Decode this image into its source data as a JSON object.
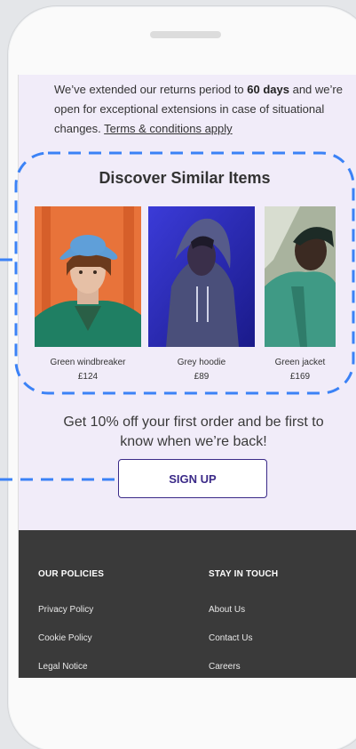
{
  "returns": {
    "text_before": "We’ve extended our returns period to ",
    "bold": "60 days",
    "text_after": " and we’re open for exceptional extensions in case of situational changes. ",
    "link": "Terms & conditions apply"
  },
  "similar": {
    "title": "Discover Similar Items",
    "items": [
      {
        "name": "Green windbreaker",
        "price": "£124"
      },
      {
        "name": "Grey hoodie",
        "price": "£89"
      },
      {
        "name": "Green jacket",
        "price": "£169"
      }
    ]
  },
  "promo": {
    "text": "Get 10% off your first order and be first to know when we’re back!",
    "button": "SIGN UP"
  },
  "footer": {
    "policies": {
      "heading": "OUR POLICIES",
      "links": [
        "Privacy Policy",
        "Cookie Policy",
        "Legal Notice"
      ]
    },
    "contact": {
      "heading": "STAY IN TOUCH",
      "links": [
        "About Us",
        "Contact Us",
        "Careers"
      ]
    }
  },
  "colors": {
    "accent": "#3b2a88",
    "annotation_dash": "#3b82f6",
    "footer_bg": "#3a3a3a",
    "screen_bg": "#f1ecf9"
  }
}
